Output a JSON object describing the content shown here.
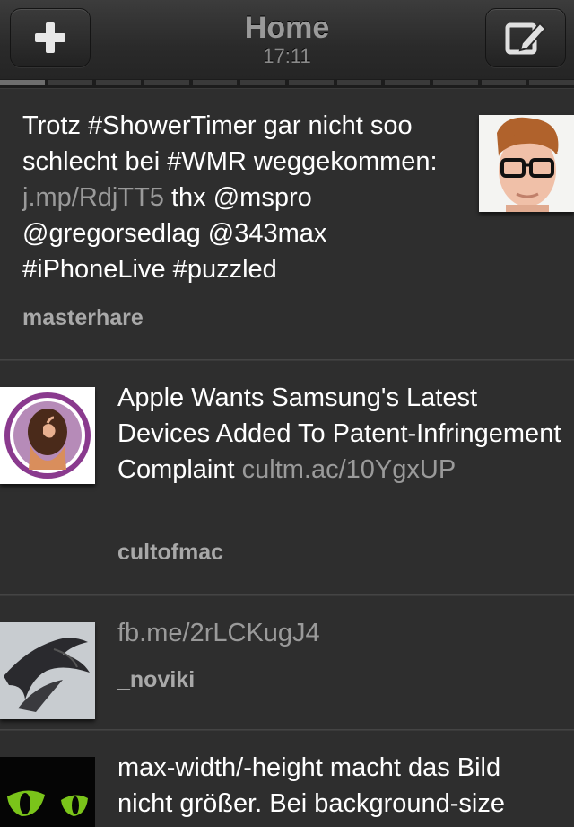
{
  "header": {
    "title": "Home",
    "time": "17:11",
    "left_button_icon": "plus-icon",
    "right_button_icon": "compose-icon",
    "segment_count": 12,
    "active_segment": 1
  },
  "tweets": [
    {
      "parts": [
        {
          "text": "Trotz #ShowerTimer gar nicht soo schlecht bei #WMR weggekommen: ",
          "type": "text"
        },
        {
          "text": "j.mp/RdjTT5",
          "type": "link"
        },
        {
          "text": " thx @mspro @gregorsedlag @343max #iPhoneLive #puzzled",
          "type": "text"
        }
      ],
      "author": "masterhare"
    },
    {
      "parts": [
        {
          "text": "Apple Wants Samsung's Latest Devices Added To Patent-Infringement Complaint ",
          "type": "text"
        },
        {
          "text": "cultm.ac/10YgxUP",
          "type": "link"
        }
      ],
      "author": "cultofmac"
    },
    {
      "parts": [
        {
          "text": "fb.me/2rLCKugJ4",
          "type": "link"
        }
      ],
      "author": "_noviki"
    },
    {
      "parts": [
        {
          "text": "max-width/-height macht das Bild nicht größer. Bei background-size",
          "type": "text"
        }
      ],
      "author": ""
    }
  ]
}
